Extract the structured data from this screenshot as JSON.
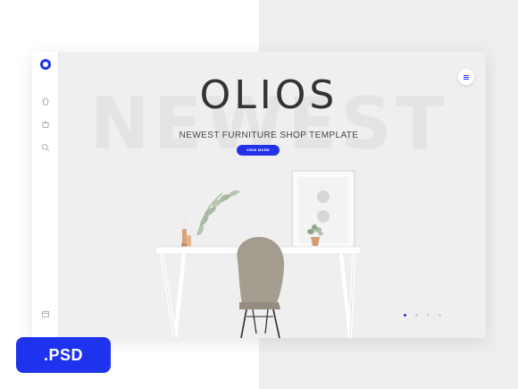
{
  "hero": {
    "watermark": "NEWEST",
    "title": "OLIOS",
    "subtitle": "NEWEST FURNITURE SHOP TEMPLATE",
    "cta_label": "VIEW MORE"
  },
  "sidebar": {
    "logo": "logo-icon",
    "icons": [
      "home-icon",
      "cart-icon",
      "search-icon",
      "account-icon"
    ]
  },
  "menu_icon": "hamburger-menu-icon",
  "slider": {
    "count": 4,
    "active_index": 0
  },
  "badge": {
    "label": ".PSD"
  },
  "colors": {
    "accent": "#2332e8",
    "badge": "#1f33ee",
    "page_right": "#eeeeee",
    "card": "#efefef"
  }
}
